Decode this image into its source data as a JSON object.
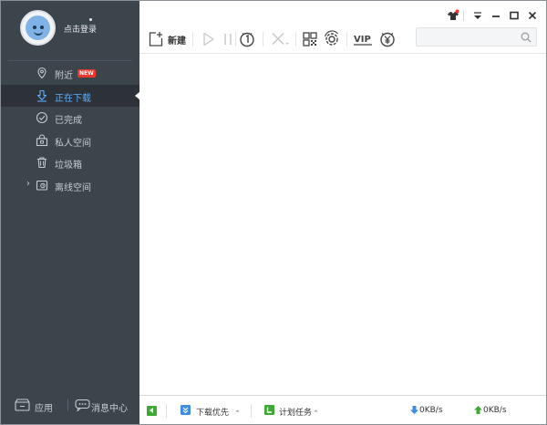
{
  "sidebar": {
    "profile": {
      "login_label": "点击登录"
    },
    "items": [
      {
        "label": "附近",
        "badge": "NEW",
        "icon": "location-pin-icon"
      },
      {
        "label": "正在下载",
        "icon": "download-arrow-icon",
        "active": true
      },
      {
        "label": "已完成",
        "icon": "check-circle-icon"
      },
      {
        "label": "私人空间",
        "icon": "lock-folder-icon"
      },
      {
        "label": "垃圾箱",
        "icon": "trash-icon"
      },
      {
        "label": "离线空间",
        "icon": "cloud-folder-icon",
        "expandable": true
      }
    ],
    "footer": {
      "app_label": "应用",
      "message_label": "消息中心"
    }
  },
  "toolbar": {
    "new_label": "新建",
    "buttons": [
      "new-task",
      "start",
      "pause",
      "speed-limit",
      "delete",
      "qr-code",
      "settings",
      "vip",
      "money"
    ],
    "vip_text": "VIP",
    "search": {
      "placeholder": "",
      "value": ""
    }
  },
  "statusbar": {
    "download_priority_label": "下载优先",
    "scheduled_task_label": "计划任务",
    "download_speed": "0KB/s",
    "upload_speed": "0KB/s"
  },
  "colors": {
    "sidebar_bg": "#3c444c",
    "active_item_bg": "#2c3238",
    "accent": "#5eaefc",
    "badge": "#e8372b"
  }
}
